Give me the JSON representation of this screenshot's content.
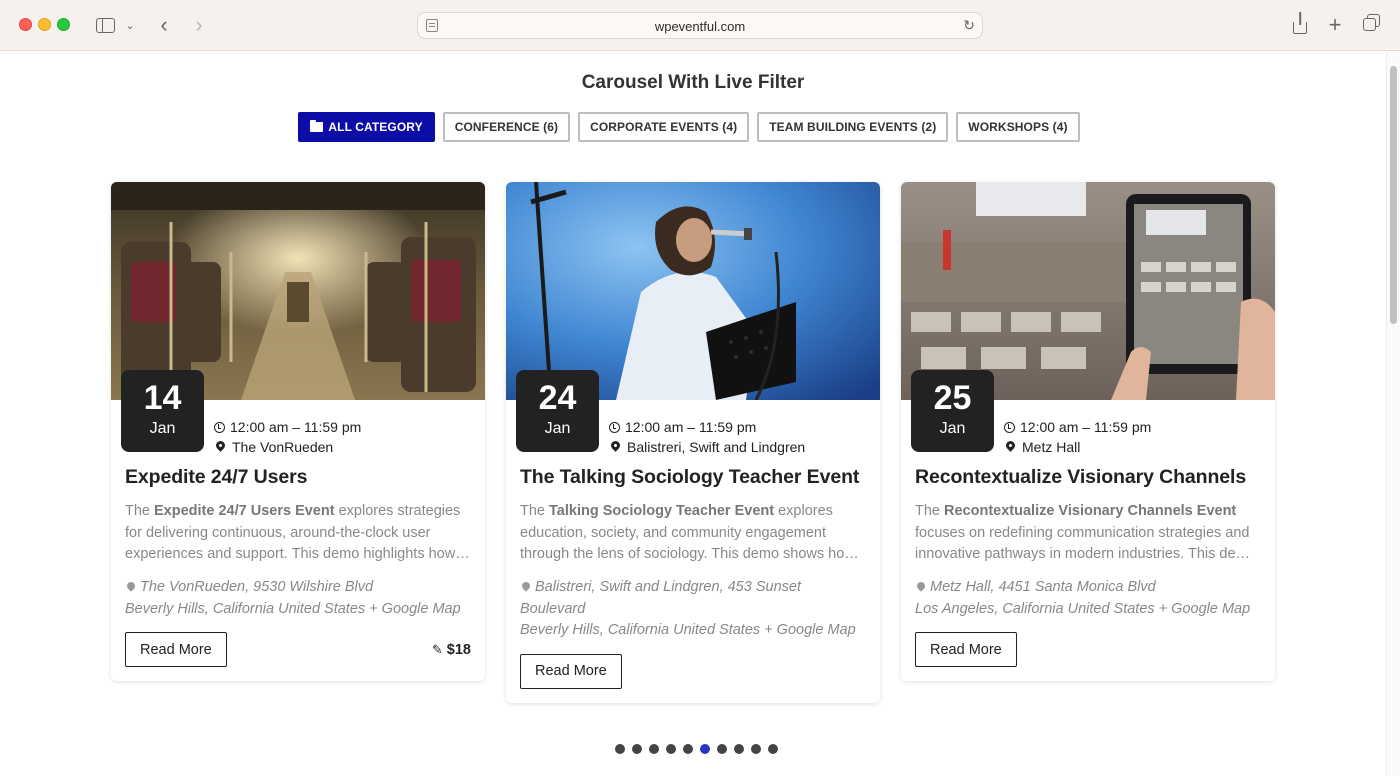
{
  "browser": {
    "url": "wpeventful.com"
  },
  "page": {
    "title": "Carousel With Live Filter"
  },
  "filters": [
    {
      "label": "ALL CATEGORY",
      "active": true
    },
    {
      "label": "CONFERENCE (6)",
      "active": false
    },
    {
      "label": "CORPORATE EVENTS (4)",
      "active": false
    },
    {
      "label": "TEAM BUILDING EVENTS (2)",
      "active": false
    },
    {
      "label": "WORKSHOPS (4)",
      "active": false
    }
  ],
  "events": [
    {
      "day": "14",
      "month": "Jan",
      "time": "12:00 am – 11:59 pm",
      "venue": "The VonRueden",
      "title": "Expedite 24/7 Users",
      "desc_pre": "The ",
      "desc_bold": "Expedite 24/7 Users Event",
      "desc_post": " explores strategies for delivering continuous, around-the-clock user experiences and support. This demo highlights how…",
      "address_line1": "The VonRueden, 9530 Wilshire Blvd",
      "address_line2": "Beverly Hills, California United States + Google Map",
      "read_more": "Read More",
      "price": "$18"
    },
    {
      "day": "24",
      "month": "Jan",
      "time": "12:00 am – 11:59 pm",
      "venue": "Balistreri, Swift and Lindgren",
      "title": "The Talking Sociology Teacher Event",
      "desc_pre": "The ",
      "desc_bold": "Talking Sociology Teacher Event",
      "desc_post": " explores education, society, and community engagement through the lens of sociology. This demo shows ho…",
      "address_line1": "Balistreri, Swift and Lindgren, 453 Sunset Boulevard",
      "address_line2": "Beverly Hills, California United States + Google Map",
      "read_more": "Read More",
      "price": ""
    },
    {
      "day": "25",
      "month": "Jan",
      "time": "12:00 am – 11:59 pm",
      "venue": "Metz Hall",
      "title": "Recontextualize Visionary Channels",
      "desc_pre": "The ",
      "desc_bold": "Recontextualize Visionary Channels Event",
      "desc_post": " focuses on redefining communication strategies and innovative pathways in modern industries. This de…",
      "address_line1": "Metz Hall, 4451 Santa Monica Blvd",
      "address_line2": "Los Angeles, California United States + Google Map",
      "read_more": "Read More",
      "price": ""
    }
  ],
  "carousel": {
    "dot_count": 10,
    "active_index": 5
  },
  "colors": {
    "accent": "#0c0ca6",
    "active_dot": "#2a34c6"
  }
}
